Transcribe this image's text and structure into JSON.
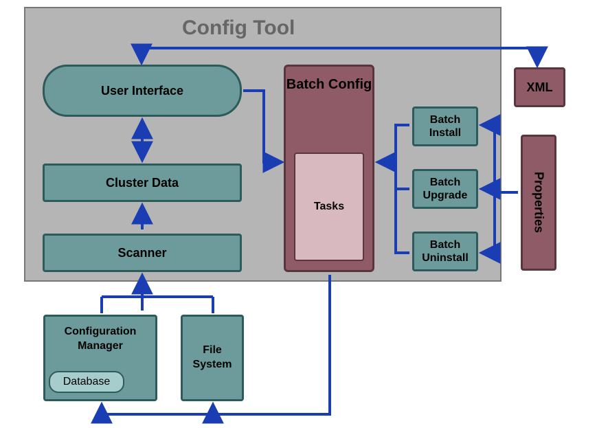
{
  "diagram": {
    "title": "Config Tool",
    "nodes": {
      "user_interface": "User Interface",
      "cluster_data": "Cluster Data",
      "scanner": "Scanner",
      "batch_config": "Batch Config",
      "tasks": "Tasks",
      "batch_install": "Batch Install",
      "batch_upgrade": "Batch Upgrade",
      "batch_uninstall": "Batch Uninstall",
      "xml": "XML",
      "properties": "Properties",
      "config_mgr": "Configuration Manager",
      "database": "Database",
      "file_system": "File System"
    }
  }
}
